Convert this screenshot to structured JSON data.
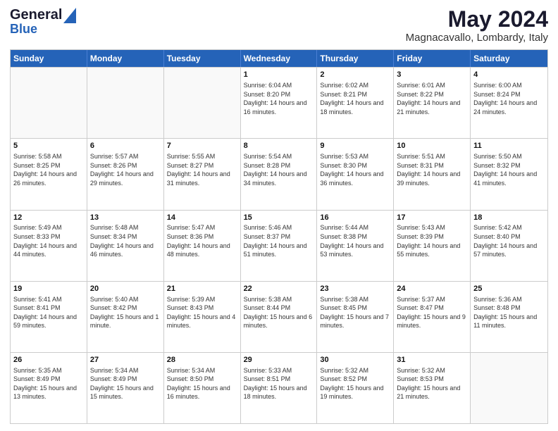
{
  "header": {
    "logo_general": "General",
    "logo_blue": "Blue",
    "month_title": "May 2024",
    "location": "Magnacavallo, Lombardy, Italy"
  },
  "days_of_week": [
    "Sunday",
    "Monday",
    "Tuesday",
    "Wednesday",
    "Thursday",
    "Friday",
    "Saturday"
  ],
  "weeks": [
    [
      {
        "day": "",
        "sunrise": "",
        "sunset": "",
        "daylight": "",
        "empty": true
      },
      {
        "day": "",
        "sunrise": "",
        "sunset": "",
        "daylight": "",
        "empty": true
      },
      {
        "day": "",
        "sunrise": "",
        "sunset": "",
        "daylight": "",
        "empty": true
      },
      {
        "day": "1",
        "sunrise": "Sunrise: 6:04 AM",
        "sunset": "Sunset: 8:20 PM",
        "daylight": "Daylight: 14 hours and 16 minutes.",
        "empty": false
      },
      {
        "day": "2",
        "sunrise": "Sunrise: 6:02 AM",
        "sunset": "Sunset: 8:21 PM",
        "daylight": "Daylight: 14 hours and 18 minutes.",
        "empty": false
      },
      {
        "day": "3",
        "sunrise": "Sunrise: 6:01 AM",
        "sunset": "Sunset: 8:22 PM",
        "daylight": "Daylight: 14 hours and 21 minutes.",
        "empty": false
      },
      {
        "day": "4",
        "sunrise": "Sunrise: 6:00 AM",
        "sunset": "Sunset: 8:24 PM",
        "daylight": "Daylight: 14 hours and 24 minutes.",
        "empty": false
      }
    ],
    [
      {
        "day": "5",
        "sunrise": "Sunrise: 5:58 AM",
        "sunset": "Sunset: 8:25 PM",
        "daylight": "Daylight: 14 hours and 26 minutes.",
        "empty": false
      },
      {
        "day": "6",
        "sunrise": "Sunrise: 5:57 AM",
        "sunset": "Sunset: 8:26 PM",
        "daylight": "Daylight: 14 hours and 29 minutes.",
        "empty": false
      },
      {
        "day": "7",
        "sunrise": "Sunrise: 5:55 AM",
        "sunset": "Sunset: 8:27 PM",
        "daylight": "Daylight: 14 hours and 31 minutes.",
        "empty": false
      },
      {
        "day": "8",
        "sunrise": "Sunrise: 5:54 AM",
        "sunset": "Sunset: 8:28 PM",
        "daylight": "Daylight: 14 hours and 34 minutes.",
        "empty": false
      },
      {
        "day": "9",
        "sunrise": "Sunrise: 5:53 AM",
        "sunset": "Sunset: 8:30 PM",
        "daylight": "Daylight: 14 hours and 36 minutes.",
        "empty": false
      },
      {
        "day": "10",
        "sunrise": "Sunrise: 5:51 AM",
        "sunset": "Sunset: 8:31 PM",
        "daylight": "Daylight: 14 hours and 39 minutes.",
        "empty": false
      },
      {
        "day": "11",
        "sunrise": "Sunrise: 5:50 AM",
        "sunset": "Sunset: 8:32 PM",
        "daylight": "Daylight: 14 hours and 41 minutes.",
        "empty": false
      }
    ],
    [
      {
        "day": "12",
        "sunrise": "Sunrise: 5:49 AM",
        "sunset": "Sunset: 8:33 PM",
        "daylight": "Daylight: 14 hours and 44 minutes.",
        "empty": false
      },
      {
        "day": "13",
        "sunrise": "Sunrise: 5:48 AM",
        "sunset": "Sunset: 8:34 PM",
        "daylight": "Daylight: 14 hours and 46 minutes.",
        "empty": false
      },
      {
        "day": "14",
        "sunrise": "Sunrise: 5:47 AM",
        "sunset": "Sunset: 8:36 PM",
        "daylight": "Daylight: 14 hours and 48 minutes.",
        "empty": false
      },
      {
        "day": "15",
        "sunrise": "Sunrise: 5:46 AM",
        "sunset": "Sunset: 8:37 PM",
        "daylight": "Daylight: 14 hours and 51 minutes.",
        "empty": false
      },
      {
        "day": "16",
        "sunrise": "Sunrise: 5:44 AM",
        "sunset": "Sunset: 8:38 PM",
        "daylight": "Daylight: 14 hours and 53 minutes.",
        "empty": false
      },
      {
        "day": "17",
        "sunrise": "Sunrise: 5:43 AM",
        "sunset": "Sunset: 8:39 PM",
        "daylight": "Daylight: 14 hours and 55 minutes.",
        "empty": false
      },
      {
        "day": "18",
        "sunrise": "Sunrise: 5:42 AM",
        "sunset": "Sunset: 8:40 PM",
        "daylight": "Daylight: 14 hours and 57 minutes.",
        "empty": false
      }
    ],
    [
      {
        "day": "19",
        "sunrise": "Sunrise: 5:41 AM",
        "sunset": "Sunset: 8:41 PM",
        "daylight": "Daylight: 14 hours and 59 minutes.",
        "empty": false
      },
      {
        "day": "20",
        "sunrise": "Sunrise: 5:40 AM",
        "sunset": "Sunset: 8:42 PM",
        "daylight": "Daylight: 15 hours and 1 minute.",
        "empty": false
      },
      {
        "day": "21",
        "sunrise": "Sunrise: 5:39 AM",
        "sunset": "Sunset: 8:43 PM",
        "daylight": "Daylight: 15 hours and 4 minutes.",
        "empty": false
      },
      {
        "day": "22",
        "sunrise": "Sunrise: 5:38 AM",
        "sunset": "Sunset: 8:44 PM",
        "daylight": "Daylight: 15 hours and 6 minutes.",
        "empty": false
      },
      {
        "day": "23",
        "sunrise": "Sunrise: 5:38 AM",
        "sunset": "Sunset: 8:45 PM",
        "daylight": "Daylight: 15 hours and 7 minutes.",
        "empty": false
      },
      {
        "day": "24",
        "sunrise": "Sunrise: 5:37 AM",
        "sunset": "Sunset: 8:47 PM",
        "daylight": "Daylight: 15 hours and 9 minutes.",
        "empty": false
      },
      {
        "day": "25",
        "sunrise": "Sunrise: 5:36 AM",
        "sunset": "Sunset: 8:48 PM",
        "daylight": "Daylight: 15 hours and 11 minutes.",
        "empty": false
      }
    ],
    [
      {
        "day": "26",
        "sunrise": "Sunrise: 5:35 AM",
        "sunset": "Sunset: 8:49 PM",
        "daylight": "Daylight: 15 hours and 13 minutes.",
        "empty": false
      },
      {
        "day": "27",
        "sunrise": "Sunrise: 5:34 AM",
        "sunset": "Sunset: 8:49 PM",
        "daylight": "Daylight: 15 hours and 15 minutes.",
        "empty": false
      },
      {
        "day": "28",
        "sunrise": "Sunrise: 5:34 AM",
        "sunset": "Sunset: 8:50 PM",
        "daylight": "Daylight: 15 hours and 16 minutes.",
        "empty": false
      },
      {
        "day": "29",
        "sunrise": "Sunrise: 5:33 AM",
        "sunset": "Sunset: 8:51 PM",
        "daylight": "Daylight: 15 hours and 18 minutes.",
        "empty": false
      },
      {
        "day": "30",
        "sunrise": "Sunrise: 5:32 AM",
        "sunset": "Sunset: 8:52 PM",
        "daylight": "Daylight: 15 hours and 19 minutes.",
        "empty": false
      },
      {
        "day": "31",
        "sunrise": "Sunrise: 5:32 AM",
        "sunset": "Sunset: 8:53 PM",
        "daylight": "Daylight: 15 hours and 21 minutes.",
        "empty": false
      },
      {
        "day": "",
        "sunrise": "",
        "sunset": "",
        "daylight": "",
        "empty": true
      }
    ]
  ]
}
